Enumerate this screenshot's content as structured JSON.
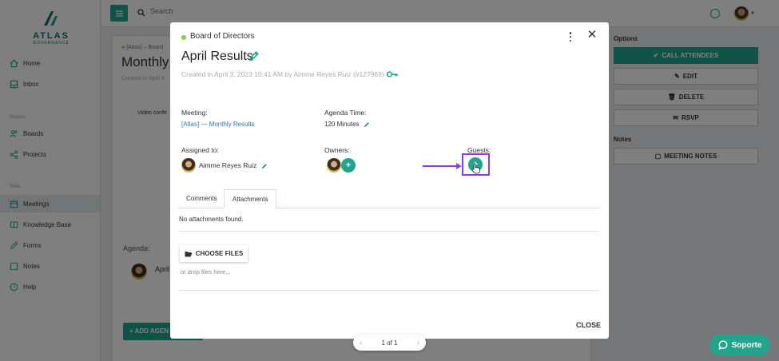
{
  "app": {
    "brand": "ATLAS",
    "brand_sub": "GOVERNANCE",
    "search_placeholder": "Search"
  },
  "sidebar": {
    "items": [
      {
        "label": "Home",
        "icon": "home-icon"
      },
      {
        "label": "Inbox",
        "icon": "inbox-icon"
      }
    ],
    "groups": [
      {
        "heading": "Groups",
        "items": [
          {
            "label": "Boards",
            "icon": "users-icon"
          },
          {
            "label": "Projects",
            "icon": "projects-icon"
          }
        ]
      },
      {
        "heading": "Tools",
        "items": [
          {
            "label": "Meetings",
            "icon": "calendar-icon",
            "active": true
          },
          {
            "label": "Knowledge Base",
            "icon": "book-icon"
          },
          {
            "label": "Forms",
            "icon": "forms-icon"
          },
          {
            "label": "Notes",
            "icon": "notes-icon"
          },
          {
            "label": "Help",
            "icon": "help-icon"
          }
        ]
      }
    ]
  },
  "background_page": {
    "breadcrumb": "[Atlas] – Board",
    "title": "Monthly",
    "created": "Created in April 3",
    "video_conf": "Video confe",
    "agenda_label": "Agenda:",
    "agenda_item": "April",
    "add_agenda": "+ ADD AGEN"
  },
  "right_panel": {
    "options_heading": "Options",
    "buttons": [
      "CALL ATTENDEES",
      "EDIT",
      "DELETE",
      "RSVP"
    ],
    "notes_heading": "Notes",
    "notes_button": "MEETING NOTES"
  },
  "modal": {
    "org": "Board of Directors",
    "title": "April Results",
    "created_line": "Created in April 3, 2023 10:41 AM by Aimme Reyes Ruiz (#127969)",
    "meeting_label": "Meeting:",
    "meeting_value": "[Atlas] — Monthly Results",
    "agenda_time_label": "Agenda Time:",
    "agenda_time_value": "120 Minutes",
    "assigned_label": "Assigned to:",
    "assigned_value": "Aimme Reyes Ruiz",
    "owners_label": "Owners:",
    "guests_label": "Guests:",
    "tabs": [
      "Comments",
      "Attachments"
    ],
    "active_tab": "Attachments",
    "no_attachments": "No attachments found.",
    "choose_files": "CHOOSE FILES",
    "drop_hint": "or drop files here...",
    "close_label": "CLOSE"
  },
  "pager": {
    "text": "1 of 1"
  },
  "support": {
    "label": "Soporte"
  },
  "colors": {
    "accent": "#23a58d",
    "highlight": "#8b3fd9",
    "status_dot": "#8dc63f",
    "link": "#2a7ab8"
  }
}
